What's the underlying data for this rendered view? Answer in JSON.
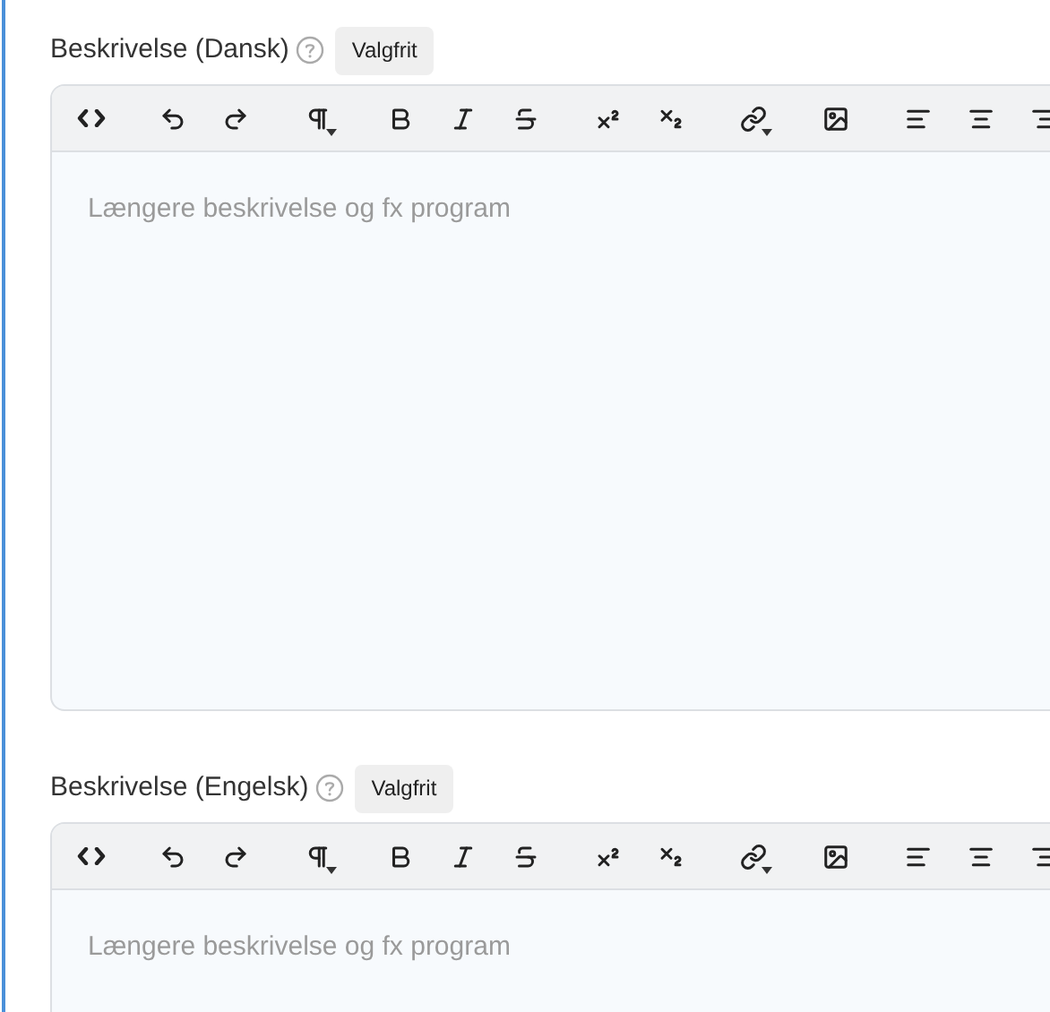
{
  "editors": [
    {
      "label": "Beskrivelse (Dansk)",
      "badge": "Valgfrit",
      "placeholder": "Længere beskrivelse og fx program",
      "toolbar": [
        [
          {
            "kind": "code",
            "dropdown": false
          }
        ],
        [
          {
            "kind": "undo",
            "dropdown": false
          },
          {
            "kind": "redo",
            "dropdown": false
          }
        ],
        [
          {
            "kind": "paragraph",
            "dropdown": true
          }
        ],
        [
          {
            "kind": "bold",
            "dropdown": false
          },
          {
            "kind": "italic",
            "dropdown": false
          },
          {
            "kind": "strike",
            "dropdown": false
          }
        ],
        [
          {
            "kind": "superscript",
            "dropdown": false
          },
          {
            "kind": "subscript",
            "dropdown": false
          }
        ],
        [
          {
            "kind": "link",
            "dropdown": true
          }
        ],
        [
          {
            "kind": "image",
            "dropdown": false
          }
        ],
        [
          {
            "kind": "align-left",
            "dropdown": false
          },
          {
            "kind": "align-center",
            "dropdown": false
          },
          {
            "kind": "align-right"
          }
        ]
      ]
    },
    {
      "label": "Beskrivelse (Engelsk)",
      "badge": "Valgfrit",
      "placeholder": "Længere beskrivelse og fx program",
      "toolbar": [
        [
          {
            "kind": "code",
            "dropdown": false
          }
        ],
        [
          {
            "kind": "undo",
            "dropdown": false
          },
          {
            "kind": "redo",
            "dropdown": false
          }
        ],
        [
          {
            "kind": "paragraph",
            "dropdown": true
          }
        ],
        [
          {
            "kind": "bold",
            "dropdown": false
          },
          {
            "kind": "italic",
            "dropdown": false
          },
          {
            "kind": "strike",
            "dropdown": false
          }
        ],
        [
          {
            "kind": "superscript",
            "dropdown": false
          },
          {
            "kind": "subscript",
            "dropdown": false
          }
        ],
        [
          {
            "kind": "link",
            "dropdown": true
          }
        ],
        [
          {
            "kind": "image",
            "dropdown": false
          }
        ],
        [
          {
            "kind": "align-left",
            "dropdown": false
          },
          {
            "kind": "align-center",
            "dropdown": false
          },
          {
            "kind": "align-right"
          }
        ]
      ]
    }
  ]
}
